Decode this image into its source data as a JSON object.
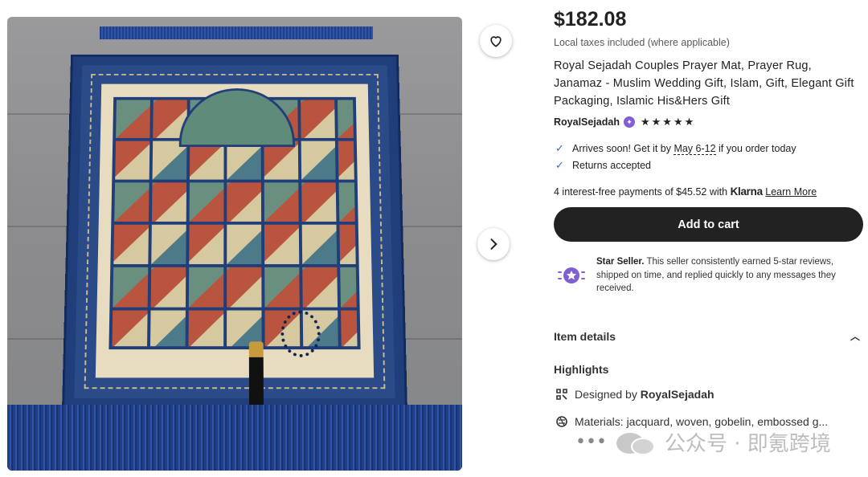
{
  "listing": {
    "price": "$182.08",
    "tax_note": "Local taxes included (where applicable)",
    "title": "Royal Sejadah Couples Prayer Mat, Prayer Rug, Janamaz - Muslim Wedding Gift, Islam, Gift, Elegant Gift Packaging, Islamic His&Hers Gift",
    "shop_name": "RoyalSejadah",
    "rating_stars": "★★★★★",
    "rating": 5
  },
  "perks": {
    "arrival_prefix": "Arrives soon! Get it by ",
    "arrival_date": "May 6-12",
    "arrival_suffix": " if you order today",
    "returns": "Returns accepted"
  },
  "klarna": {
    "prefix": "4 interest-free payments of $45.52 with ",
    "logo": "Klarna",
    "learn_more": "Learn More"
  },
  "cart": {
    "label": "Add to cart"
  },
  "star_seller": {
    "heading": "Star Seller.",
    "text": " This seller consistently earned 5-star reviews, shipped on time, and replied quickly to any messages they received."
  },
  "details": {
    "section_label": "Item details",
    "highlights_label": "Highlights",
    "designed_by_prefix": "Designed by ",
    "designer": "RoyalSejadah",
    "materials": "Materials: jacquard, woven, gobelin, embossed g..."
  },
  "watermark": {
    "text": "公众号 · 即氪跨境",
    "dots": "•••"
  },
  "colors": {
    "accent_purple": "#7f5fd1",
    "check_blue": "#3b67c9",
    "button_dark": "#222222"
  },
  "icons": [
    "heart-icon",
    "chevron-right-icon",
    "check-icon",
    "star-seller-icon",
    "chevron-up-icon",
    "designer-icon",
    "materials-icon"
  ]
}
